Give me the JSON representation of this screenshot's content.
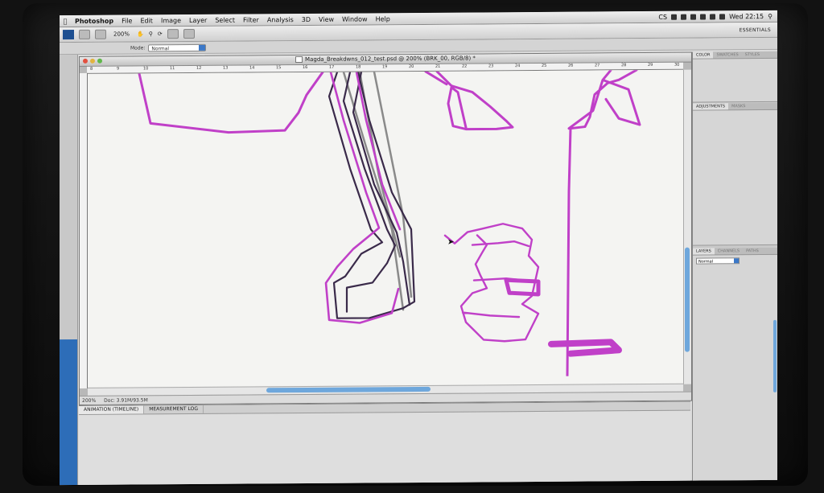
{
  "menubar": {
    "app_name": "Photoshop",
    "items": [
      "File",
      "Edit",
      "Image",
      "Layer",
      "Select",
      "Filter",
      "Analysis",
      "3D",
      "View",
      "Window",
      "Help"
    ],
    "clock": "Wed 22:15",
    "tray_label": "CS"
  },
  "appbar": {
    "zoom": "200%",
    "workspace": "ESSENTIALS"
  },
  "options": {
    "mode_label": "Mode:",
    "mode_value": "Normal"
  },
  "document": {
    "title": "Magda_Breakdwns_012_test.psd @ 200% (BRK_00, RGB/8) *",
    "ruler_ticks": [
      "8",
      "9",
      "10",
      "11",
      "12",
      "13",
      "14",
      "15",
      "16",
      "17",
      "18",
      "19",
      "20",
      "21",
      "22",
      "23",
      "24",
      "25",
      "26",
      "27",
      "28",
      "29",
      "30"
    ],
    "status_zoom": "200%",
    "status_doc": "Doc: 3.91M/93.5M"
  },
  "bottom_panel": {
    "tabs": [
      "ANIMATION (TIMELINE)",
      "MEASUREMENT LOG"
    ]
  },
  "panels": {
    "color_tabs": [
      "COLOR",
      "SWATCHES",
      "STYLES"
    ],
    "adjust_tabs": [
      "ADJUSTMENTS",
      "MASKS"
    ],
    "layers_tabs": [
      "LAYERS",
      "CHANNELS",
      "PATHS"
    ],
    "layers_mode": "Normal"
  },
  "colors": {
    "magenta_stroke": "#c040c8",
    "dark_stroke": "#3a2a4a",
    "scroll_blue": "#6ea7dc"
  }
}
